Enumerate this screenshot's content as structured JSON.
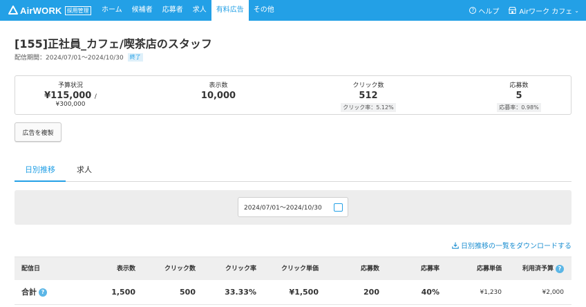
{
  "header": {
    "logo_text": "AirWORK",
    "logo_badge": "採用管理",
    "nav": [
      {
        "label": "ホーム"
      },
      {
        "label": "候補者"
      },
      {
        "label": "応募者"
      },
      {
        "label": "求人"
      },
      {
        "label": "有料広告"
      },
      {
        "label": "その他"
      }
    ],
    "help_label": "ヘルプ",
    "account_label": "Airワーク カフェ",
    "accent_color": "#23a0e6"
  },
  "job": {
    "title": "[155]正社員_カフェ/喫茶店のスタッフ",
    "period_label": "配信期間：2024/07/01〜2024/10/30",
    "status": "終了"
  },
  "stats": {
    "budget": {
      "label": "予算状況",
      "value": "¥115,000",
      "separator": "/",
      "total": "¥300,000"
    },
    "impressions": {
      "label": "表示数",
      "value": "10,000"
    },
    "clicks": {
      "label": "クリック数",
      "value": "512",
      "rate": "クリック率：5.12%"
    },
    "applications": {
      "label": "応募数",
      "value": "5",
      "rate": "応募率：0.98%"
    }
  },
  "actions": {
    "copy_label": "広告を複製"
  },
  "tabs": [
    {
      "label": "日別推移"
    },
    {
      "label": "求人"
    }
  ],
  "filter": {
    "date_range": "2024/07/01〜2024/10/30"
  },
  "download_label": "日別推移の一覧をダウンロードする",
  "table": {
    "headers": [
      "配信日",
      "表示数",
      "クリック数",
      "クリック率",
      "クリック単価",
      "応募数",
      "応募率",
      "応募単価",
      "利用済予算"
    ],
    "total_row": {
      "label": "合計",
      "impressions": "1,500",
      "clicks": "500",
      "click_rate": "33.33%",
      "cpc": "¥1,500",
      "applications": "200",
      "apply_rate": "40%",
      "cpa": "¥1,230",
      "used_budget": "¥2,000"
    }
  }
}
